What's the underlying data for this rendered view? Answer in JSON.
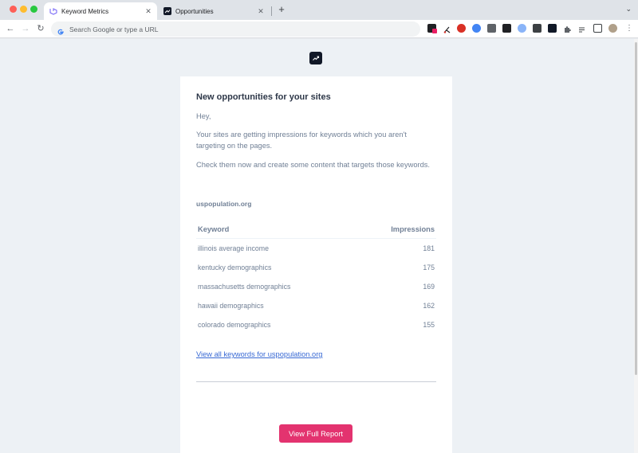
{
  "browser": {
    "tabs": [
      {
        "title": "Keyword Metrics",
        "close": "✕"
      },
      {
        "title": "Opportunities",
        "close": "✕"
      }
    ],
    "new_tab": "+",
    "tab_menu": "⌄",
    "nav": {
      "back": "←",
      "forward": "→",
      "reload": "↻"
    },
    "omnibox": {
      "placeholder": "Search Google or type a URL"
    },
    "menu": "⋮",
    "extension_icons": [
      "color-picker-icon",
      "cut-icon",
      "block-icon",
      "camera-icon",
      "grid-icon",
      "d-icon",
      "g-icon",
      "meter-icon",
      "trend-icon",
      "puzzle-icon",
      "reading-list-icon",
      "sidebar-icon",
      "profile-avatar"
    ]
  },
  "email": {
    "heading": "New opportunities for your sites",
    "greeting": "Hey,",
    "paragraph1": "Your sites are getting impressions for keywords which you aren't targeting on the pages.",
    "paragraph2": "Check them now and create some content that targets those keywords.",
    "site": "uspopulation.org",
    "table": {
      "headers": [
        "Keyword",
        "Impressions"
      ],
      "rows": [
        {
          "keyword": "illinois average income",
          "impressions": "181"
        },
        {
          "keyword": "kentucky demographics",
          "impressions": "175"
        },
        {
          "keyword": "massachusetts demographics",
          "impressions": "169"
        },
        {
          "keyword": "hawaii demographics",
          "impressions": "162"
        },
        {
          "keyword": "colorado demographics",
          "impressions": "155"
        }
      ]
    },
    "link": "View all keywords for uspopulation.org",
    "button": "View Full Report"
  },
  "colors": {
    "accent": "#e3336f",
    "link": "#3869d4",
    "text_muted": "#718096",
    "heading": "#2d3748"
  }
}
